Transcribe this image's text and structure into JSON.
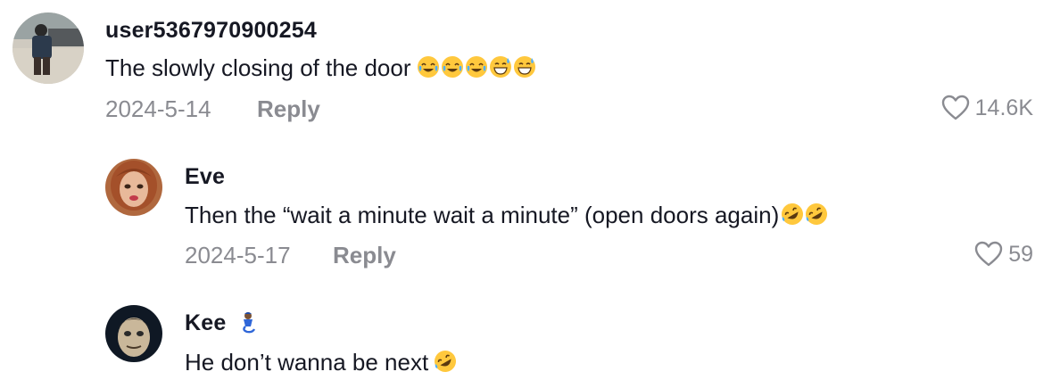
{
  "comments": [
    {
      "username": "user5367970900254",
      "text": "The slowly closing of the door",
      "emojis": [
        "joy-emoji",
        "joy-emoji",
        "joy-emoji",
        "grin-sweat-emoji",
        "grin-sweat-emoji"
      ],
      "date": "2024-5-14",
      "reply_label": "Reply",
      "likes": "14.6K"
    },
    {
      "username": "Eve",
      "text": "Then the “wait a minute wait a minute” (open doors again)",
      "emojis": [
        "rofl-emoji",
        "rofl-emoji"
      ],
      "date": "2024-5-17",
      "reply_label": "Reply",
      "likes": "59"
    },
    {
      "username": "Kee",
      "username_emoji": "genie-emoji",
      "text": "He don’t wanna be next",
      "emojis": [
        "rofl-emoji"
      ]
    }
  ],
  "colors": {
    "primary_text": "#161823",
    "secondary_text": "#8a8b91",
    "emoji_yellow": "#ffc83d"
  }
}
